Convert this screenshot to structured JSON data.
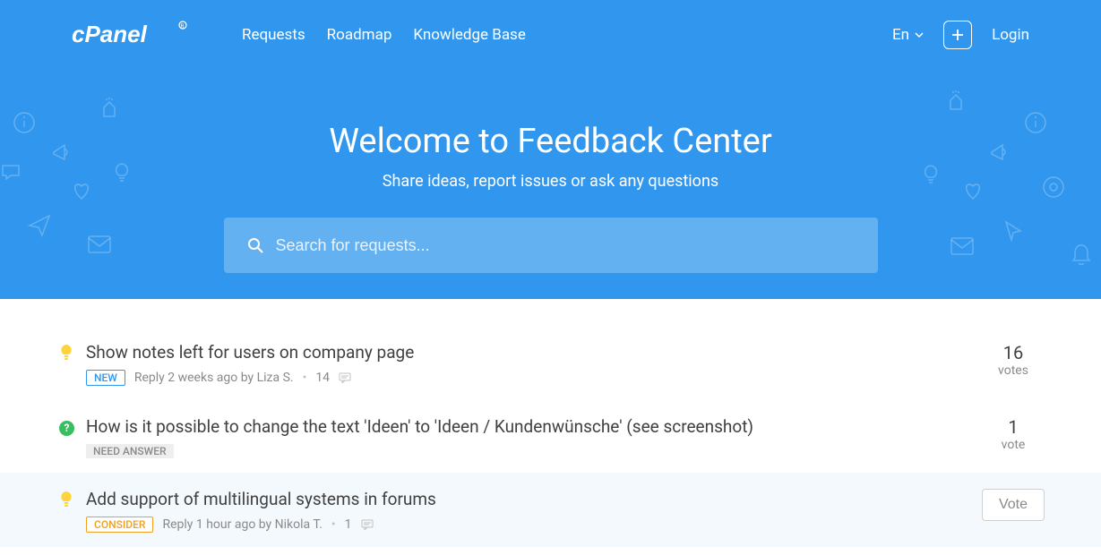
{
  "brand": "cPanel",
  "nav": {
    "requests": "Requests",
    "roadmap": "Roadmap",
    "knowledge": "Knowledge Base"
  },
  "lang": "En",
  "login": "Login",
  "hero": {
    "title": "Welcome to Feedback Center",
    "subtitle": "Share ideas, report issues or ask any questions"
  },
  "search": {
    "placeholder": "Search for requests..."
  },
  "rows": [
    {
      "icon": "bulb",
      "title": "Show notes left for users on company page",
      "badge": "NEW",
      "badge_class": "new",
      "meta": "Reply 2 weeks ago by Liza S.",
      "comments": "14",
      "votes": "16",
      "votes_label": "votes"
    },
    {
      "icon": "help",
      "title": "How is it possible to change the text 'Ideen' to 'Ideen / Kundenwünsche' (see screenshot)",
      "badge": "NEED ANSWER",
      "badge_class": "need",
      "meta": "",
      "comments": "",
      "votes": "1",
      "votes_label": "vote"
    },
    {
      "icon": "bulb",
      "title": "Add support of multilingual systems in forums",
      "badge": "CONSIDER",
      "badge_class": "consider",
      "meta": "Reply 1 hour ago by Nikola T.",
      "comments": "1",
      "votes": "",
      "votes_label": "",
      "vote_btn": "Vote",
      "hover": true
    }
  ]
}
